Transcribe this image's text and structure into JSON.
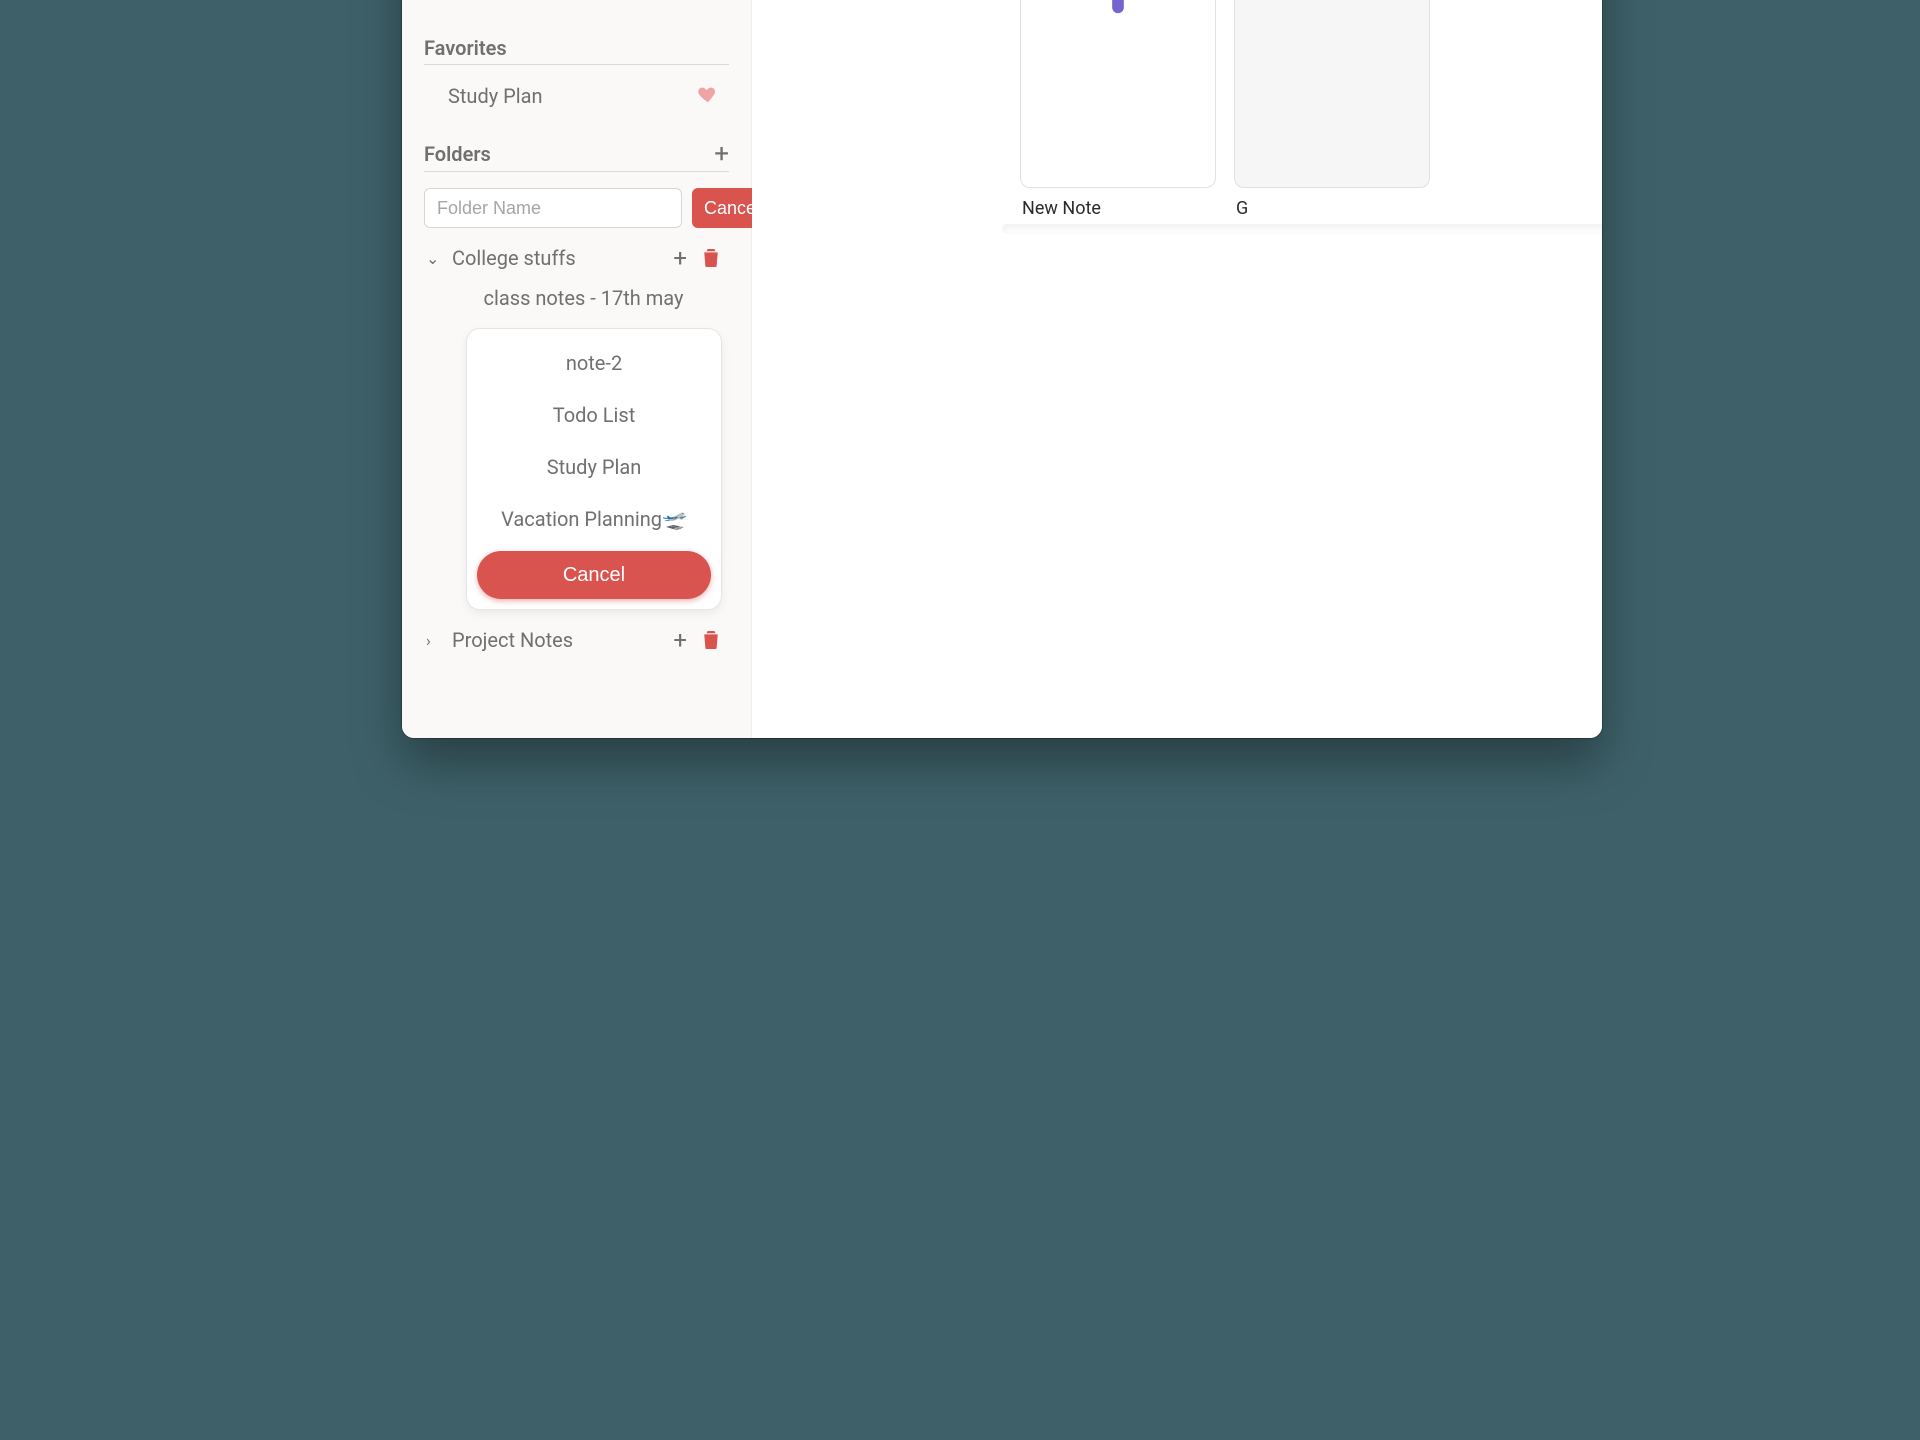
{
  "sidebar": {
    "favorites_title": "Favorites",
    "favorites": [
      {
        "label": "Study Plan"
      }
    ],
    "folders_title": "Folders",
    "folder_input_placeholder": "Folder Name",
    "folder_input_cancel": "Cancel",
    "folders": [
      {
        "name": "College stuffs",
        "expanded": true,
        "children": [
          "class notes - 17th may"
        ],
        "move_options": [
          "note-2",
          "Todo List",
          "Study Plan",
          "Vacation Planning🛫"
        ],
        "card_cancel": "Cancel"
      },
      {
        "name": "Project Notes",
        "expanded": false
      }
    ]
  },
  "main": {
    "cards": [
      {
        "label": "New Note",
        "is_new": true
      },
      {
        "label": "G"
      }
    ]
  }
}
